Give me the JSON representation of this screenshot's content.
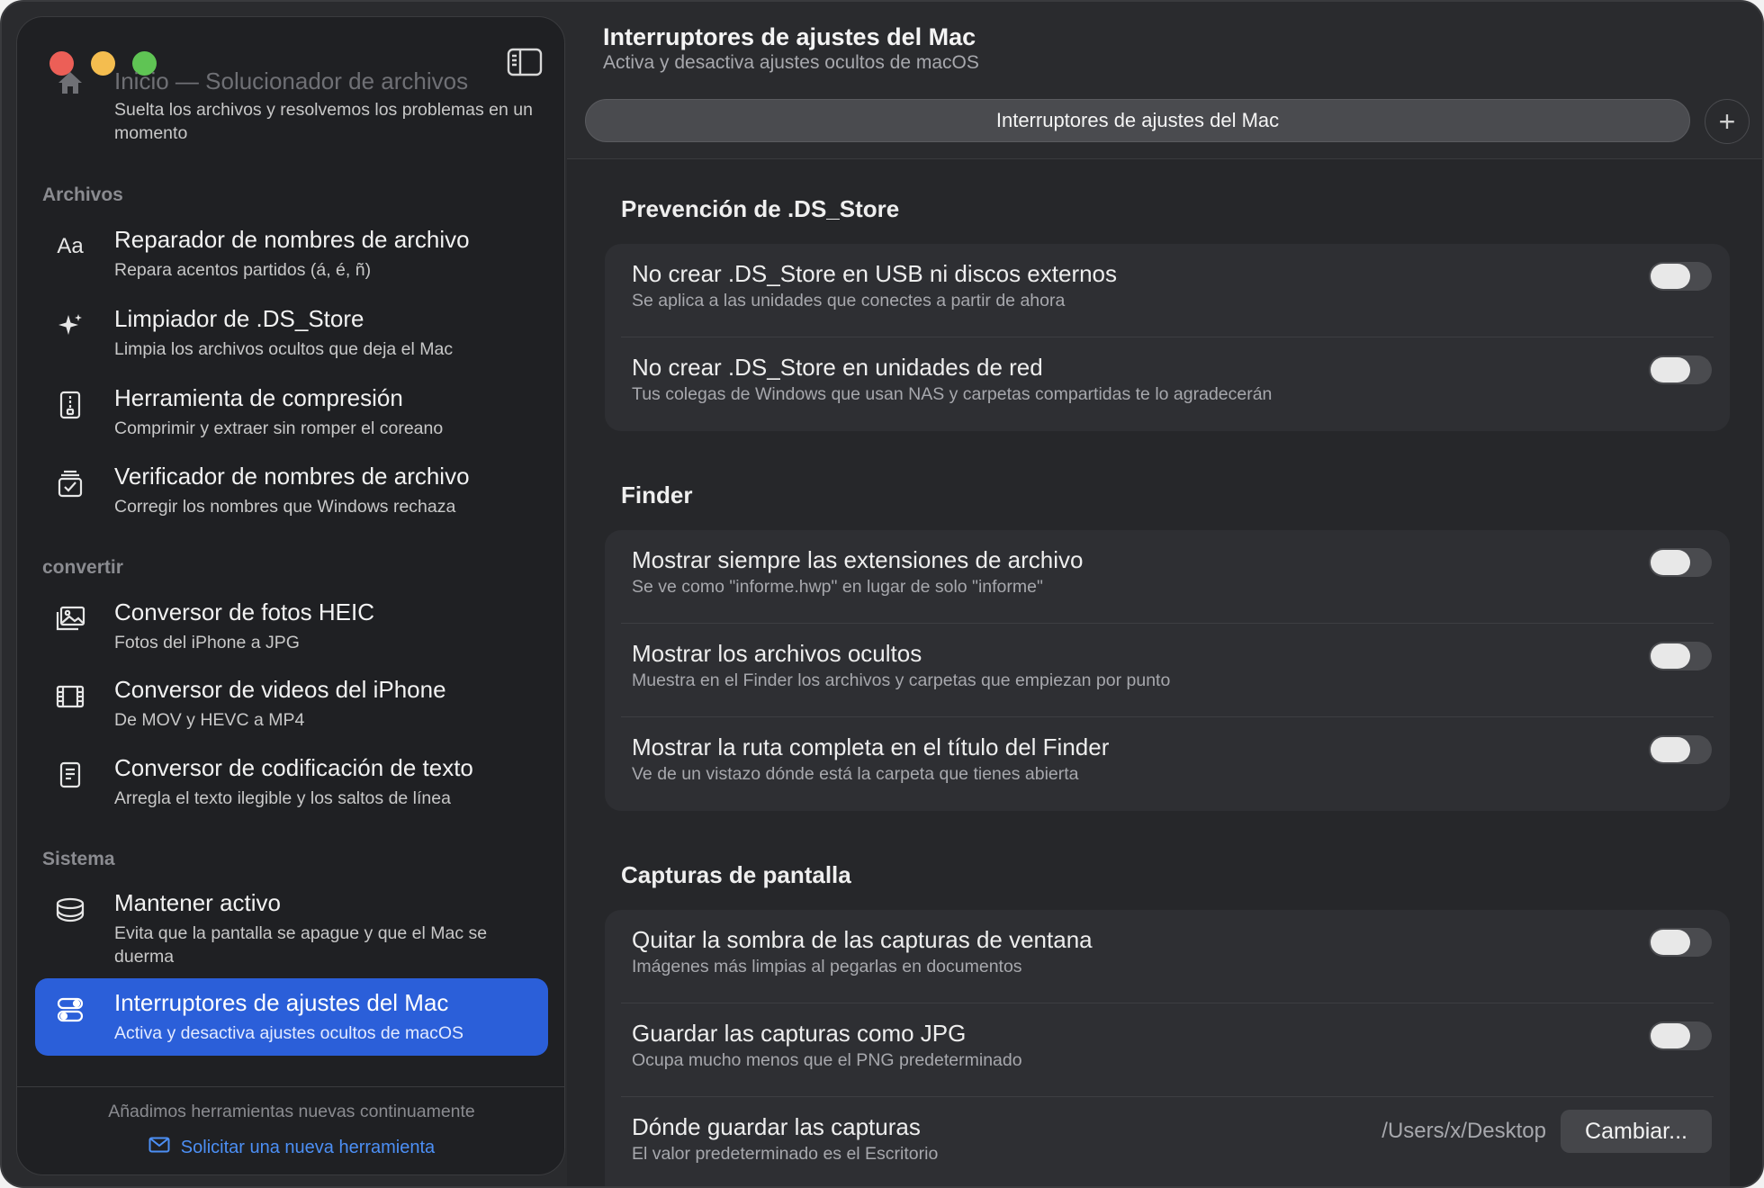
{
  "sidebar": {
    "home": {
      "title": "Inicio — Solucionador de archivos",
      "subtitle": "Suelta los archivos y resolvemos los problemas en un momento"
    },
    "sections": {
      "files": "Archivos",
      "convert": "convertir",
      "system": "Sistema"
    },
    "items": [
      {
        "title": "Reparador de nombres de archivo",
        "subtitle": "Repara acentos partidos (á, é, ñ)",
        "icon_text": "Aa"
      },
      {
        "title": "Limpiador de .DS_Store",
        "subtitle": "Limpia los archivos ocultos que deja el Mac"
      },
      {
        "title": "Herramienta de compresión",
        "subtitle": "Comprimir y extraer sin romper el coreano"
      },
      {
        "title": "Verificador de nombres de archivo",
        "subtitle": "Corregir los nombres que Windows rechaza"
      },
      {
        "title": "Conversor de fotos HEIC",
        "subtitle": "Fotos del iPhone a JPG"
      },
      {
        "title": "Conversor de videos del iPhone",
        "subtitle": "De MOV y HEVC a MP4"
      },
      {
        "title": "Conversor de codificación de texto",
        "subtitle": "Arregla el texto ilegible y los saltos de línea"
      },
      {
        "title": "Mantener activo",
        "subtitle": "Evita que la pantalla se apague y que el Mac se duerma"
      },
      {
        "title": "Interruptores de ajustes del Mac",
        "subtitle": "Activa y desactiva ajustes ocultos de macOS"
      }
    ],
    "footer_text": "Añadimos herramientas nuevas continuamente",
    "request_link": "Solicitar una nueva herramienta"
  },
  "main": {
    "title": "Interruptores de ajustes del Mac",
    "subtitle": "Activa y desactiva ajustes ocultos de macOS",
    "tab_label": "Interruptores de ajustes del Mac",
    "sections": [
      {
        "title": "Prevención de .DS_Store",
        "rows": [
          {
            "title": "No crear .DS_Store en USB ni discos externos",
            "subtitle": "Se aplica a las unidades que conectes a partir de ahora",
            "on": false
          },
          {
            "title": "No crear .DS_Store en unidades de red",
            "subtitle": "Tus colegas de Windows que usan NAS y carpetas compartidas te lo agradecerán",
            "on": false
          }
        ]
      },
      {
        "title": "Finder",
        "rows": [
          {
            "title": "Mostrar siempre las extensiones de archivo",
            "subtitle": "Se ve como \"informe.hwp\" en lugar de solo \"informe\"",
            "on": false
          },
          {
            "title": "Mostrar los archivos ocultos",
            "subtitle": "Muestra en el Finder los archivos y carpetas que empiezan por punto",
            "on": false
          },
          {
            "title": "Mostrar la ruta completa en el título del Finder",
            "subtitle": "Ve de un vistazo dónde está la carpeta que tienes abierta",
            "on": false
          }
        ]
      },
      {
        "title": "Capturas de pantalla",
        "rows": [
          {
            "title": "Quitar la sombra de las capturas de ventana",
            "subtitle": "Imágenes más limpias al pegarlas en documentos",
            "on": false
          },
          {
            "title": "Guardar las capturas como JPG",
            "subtitle": "Ocupa mucho menos que el PNG predeterminado",
            "on": false
          },
          {
            "title": "Dónde guardar las capturas",
            "subtitle": "El valor predeterminado es el Escritorio",
            "value": "/Users/x/Desktop",
            "button": "Cambiar..."
          }
        ]
      }
    ]
  },
  "colors": {
    "accent": "#2b5fd9",
    "link": "#4c8ff5",
    "window_bg": "#2a2b2e",
    "sidebar_bg": "#1f2023",
    "card_bg": "#2e2f33"
  }
}
